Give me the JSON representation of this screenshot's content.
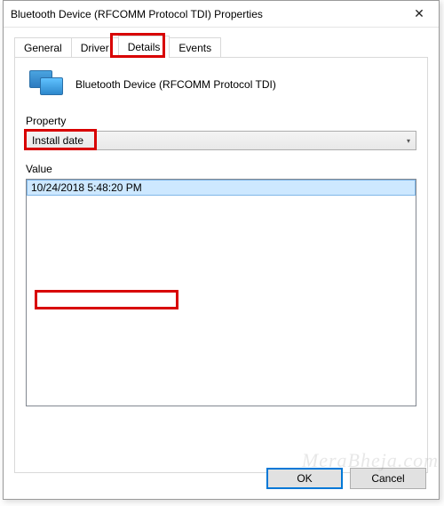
{
  "window": {
    "title": "Bluetooth Device (RFCOMM Protocol TDI) Properties"
  },
  "tabs": {
    "general": "General",
    "driver": "Driver",
    "details": "Details",
    "events": "Events",
    "active": "details"
  },
  "device": {
    "name": "Bluetooth Device (RFCOMM Protocol TDI)"
  },
  "property": {
    "label": "Property",
    "selected": "Install date"
  },
  "value": {
    "label": "Value",
    "items": [
      "10/24/2018 5:48:20 PM"
    ]
  },
  "buttons": {
    "ok": "OK",
    "cancel": "Cancel"
  },
  "watermark": "MeraBheja.com"
}
